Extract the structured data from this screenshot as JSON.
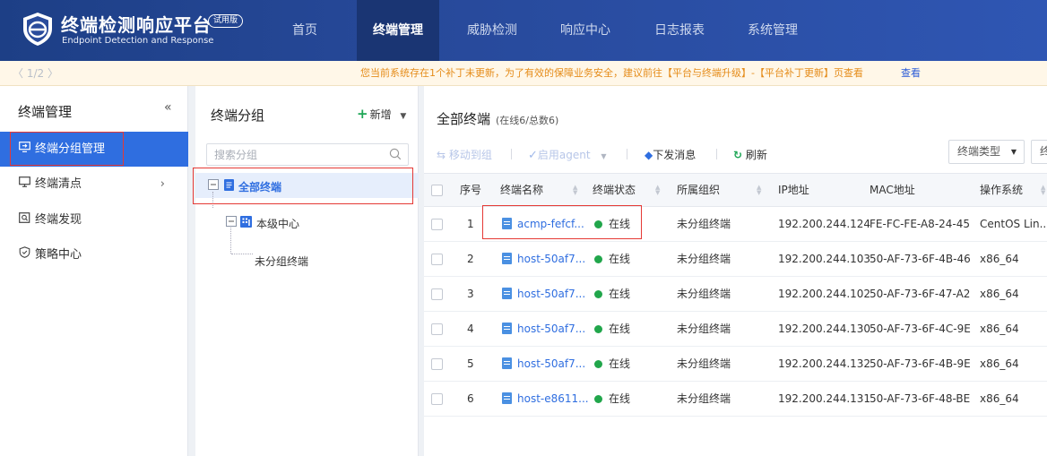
{
  "header": {
    "title": "终端检测响应平台",
    "badge": "试用版",
    "subtitle": "Endpoint Detection and Response",
    "nav": [
      "首页",
      "终端管理",
      "威胁检测",
      "响应中心",
      "日志报表",
      "系统管理"
    ],
    "active_nav": "终端管理"
  },
  "notice": {
    "pager": "〈 1/2 〉",
    "text": "您当前系统存在1个补丁未更新，为了有效的保障业务安全，建议前往【平台与终端升级】-【平台补丁更新】页查看",
    "link": "查看"
  },
  "sidebar": {
    "title": "终端管理",
    "collapse_icon": "«",
    "items": [
      {
        "label": "终端分组管理",
        "icon": "monitor-arrow-icon",
        "active": true
      },
      {
        "label": "终端清点",
        "icon": "monitor-icon",
        "arrow": "›"
      },
      {
        "label": "终端发现",
        "icon": "search-box-icon"
      },
      {
        "label": "策略中心",
        "icon": "shield-icon"
      }
    ]
  },
  "group_panel": {
    "title": "终端分组",
    "add_label": "新增",
    "search_placeholder": "搜索分组",
    "tree": {
      "root": "全部终端",
      "child": "本级中心",
      "grandchild": "未分组终端"
    }
  },
  "table_panel": {
    "title": "全部终端",
    "subtitle": "(在线6/总数6)",
    "toolbar": {
      "move": "移动到组",
      "enable_agent": "启用agent",
      "send_msg": "下发消息",
      "refresh": "刷新"
    },
    "filter_type": "终端类型",
    "filter_more": "终",
    "columns": [
      "序号",
      "终端名称",
      "终端状态",
      "所属组织",
      "IP地址",
      "MAC地址",
      "操作系统"
    ],
    "rows": [
      {
        "no": "1",
        "name": "acmp-fefcf...",
        "status": "在线",
        "org": "未分组终端",
        "ip": "192.200.244.124",
        "mac": "FE-FC-FE-A8-24-45",
        "os": "CentOS Lin..."
      },
      {
        "no": "2",
        "name": "host-50af7...",
        "status": "在线",
        "org": "未分组终端",
        "ip": "192.200.244.103",
        "mac": "50-AF-73-6F-4B-46",
        "os": "x86_64"
      },
      {
        "no": "3",
        "name": "host-50af7...",
        "status": "在线",
        "org": "未分组终端",
        "ip": "192.200.244.102",
        "mac": "50-AF-73-6F-47-A2",
        "os": "x86_64"
      },
      {
        "no": "4",
        "name": "host-50af7...",
        "status": "在线",
        "org": "未分组终端",
        "ip": "192.200.244.130",
        "mac": "50-AF-73-6F-4C-9E",
        "os": "x86_64"
      },
      {
        "no": "5",
        "name": "host-50af7...",
        "status": "在线",
        "org": "未分组终端",
        "ip": "192.200.244.132",
        "mac": "50-AF-73-6F-4B-9E",
        "os": "x86_64"
      },
      {
        "no": "6",
        "name": "host-e8611...",
        "status": "在线",
        "org": "未分组终端",
        "ip": "192.200.244.131",
        "mac": "50-AF-73-6F-48-BE",
        "os": "x86_64"
      }
    ]
  },
  "colors": {
    "header_bg": "#27499a",
    "accent": "#2f6ee0",
    "online": "#21a64b",
    "notice_text": "#e58c1a",
    "highlight": "#e53935"
  }
}
